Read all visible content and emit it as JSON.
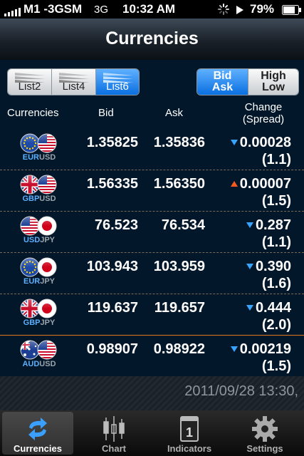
{
  "status": {
    "carrier": "M1 -3GSM",
    "network": "3G",
    "time": "10:32 AM",
    "battery": "79%"
  },
  "nav": {
    "title": "Currencies"
  },
  "list_segment": [
    {
      "label": "List2",
      "active": false
    },
    {
      "label": "List4",
      "active": false
    },
    {
      "label": "List6",
      "active": true
    }
  ],
  "price_segment": [
    {
      "line1": "Bid",
      "line2": "Ask",
      "active": true
    },
    {
      "line1": "High",
      "line2": "Low",
      "active": false
    }
  ],
  "headers": {
    "currencies": "Currencies",
    "bid": "Bid",
    "ask": "Ask",
    "change": "Change",
    "spread": "(Spread)"
  },
  "rows": [
    {
      "base": "EUR",
      "quote": "USD",
      "bid": "1.35825",
      "ask": "1.35836",
      "change": "0.00028",
      "spread": "(1.1)",
      "direction": "down"
    },
    {
      "base": "GBP",
      "quote": "USD",
      "bid": "1.56335",
      "ask": "1.56350",
      "change": "0.00007",
      "spread": "(1.5)",
      "direction": "up"
    },
    {
      "base": "USD",
      "quote": "JPY",
      "bid": "76.523",
      "ask": "76.534",
      "change": "0.287",
      "spread": "(1.1)",
      "direction": "down"
    },
    {
      "base": "EUR",
      "quote": "JPY",
      "bid": "103.943",
      "ask": "103.959",
      "change": "0.390",
      "spread": "(1.6)",
      "direction": "down"
    },
    {
      "base": "GBP",
      "quote": "JPY",
      "bid": "119.637",
      "ask": "119.657",
      "change": "0.444",
      "spread": "(2.0)",
      "direction": "down"
    },
    {
      "base": "AUD",
      "quote": "USD",
      "bid": "0.98907",
      "ask": "0.98922",
      "change": "0.00219",
      "spread": "(1.5)",
      "direction": "down"
    }
  ],
  "footer": {
    "timestamp": "2011/09/28  13:30,"
  },
  "tabs": [
    {
      "label": "Currencies",
      "icon": "refresh-arrows-icon",
      "active": true
    },
    {
      "label": "Chart",
      "icon": "candlestick-icon",
      "active": false
    },
    {
      "label": "Indicators",
      "icon": "calendar-icon",
      "active": false
    },
    {
      "label": "Settings",
      "icon": "gear-icon",
      "active": false
    }
  ],
  "indicators_icon_number": "1",
  "colors": {
    "accent_blue": "#0a6fe0",
    "down_arrow": "#39a4ff",
    "up_arrow": "#ff5a1e",
    "background": "#03172a"
  }
}
